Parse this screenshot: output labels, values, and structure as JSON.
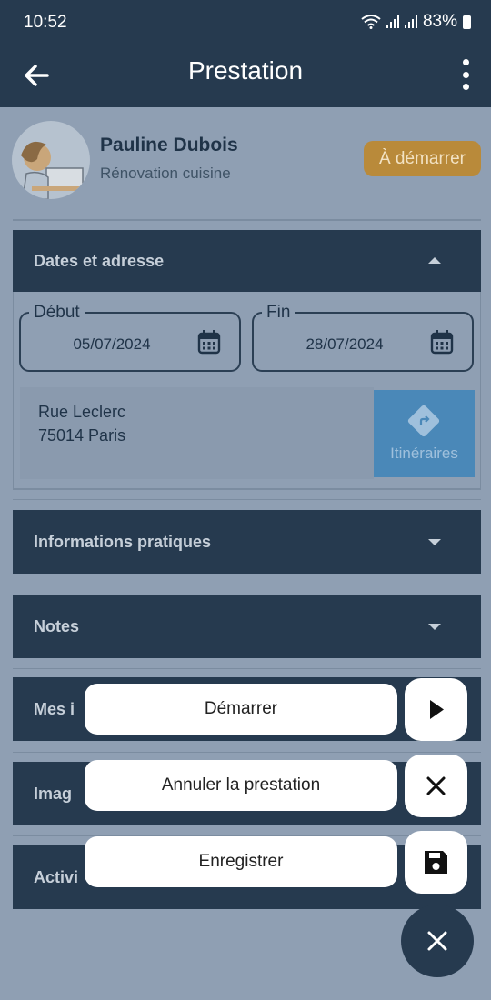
{
  "statusbar": {
    "time": "10:52",
    "battery": "83%"
  },
  "appbar": {
    "title": "Prestation"
  },
  "client": {
    "name": "Pauline Dubois",
    "job": "Rénovation cuisine",
    "status": "À démarrer"
  },
  "sections": {
    "dates": {
      "title": "Dates et adresse"
    },
    "infos": {
      "title": "Informations pratiques"
    },
    "notes": {
      "title": "Notes"
    },
    "mes": {
      "title": "Mes i"
    },
    "images": {
      "title": "Imag"
    },
    "activite": {
      "title": "Activi"
    }
  },
  "dates": {
    "start_label": "Début",
    "start_value": "05/07/2024",
    "end_label": "Fin",
    "end_value": "28/07/2024"
  },
  "address": {
    "line1": "Rue Leclerc",
    "line2": "75014 Paris",
    "route_label": "Itinéraires"
  },
  "actions": {
    "start": "Démarrer",
    "cancel": "Annuler la prestation",
    "save": "Enregistrer"
  },
  "colors": {
    "primary": "#263a4f",
    "badge": "#b98a3a",
    "route": "#4a88b8"
  }
}
